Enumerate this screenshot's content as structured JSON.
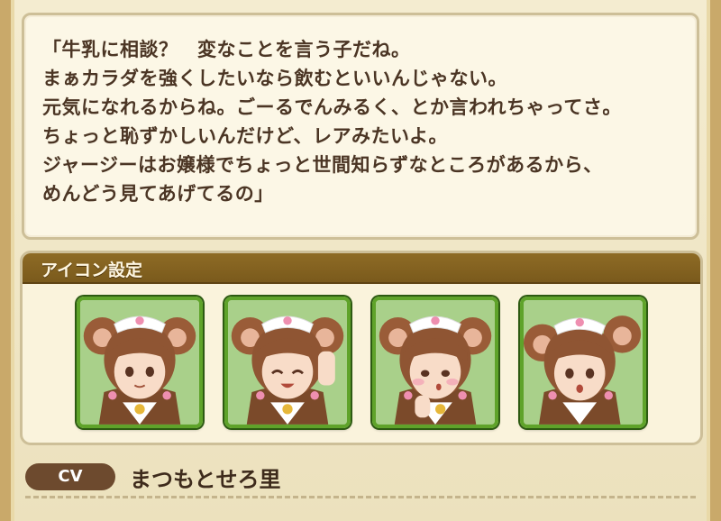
{
  "quote": {
    "lines": [
      "「牛乳に相談？　変なことを言う子だね。",
      "まぁカラダを強くしたいなら飲むといいんじゃない。",
      "元気になれるからね。ごーるでんみるく、とか言われちゃってさ。",
      "ちょっと恥ずかしいんだけど、レアみたいよ。",
      "ジャージーはお嬢様でちょっと世間知らずなところがあるから、",
      "めんどう見てあげてるの」"
    ]
  },
  "icon_section": {
    "title": "アイコン設定",
    "portraits": [
      {
        "expression": "smile"
      },
      {
        "expression": "laugh"
      },
      {
        "expression": "shy"
      },
      {
        "expression": "surprised"
      }
    ]
  },
  "cv": {
    "label": "CV",
    "name": "まつもとせろ里"
  },
  "colors": {
    "header_bg": "#8e6b25",
    "portrait_border": "#5fa32a",
    "text": "#4b3524",
    "cv_badge": "#6d4a2e"
  }
}
